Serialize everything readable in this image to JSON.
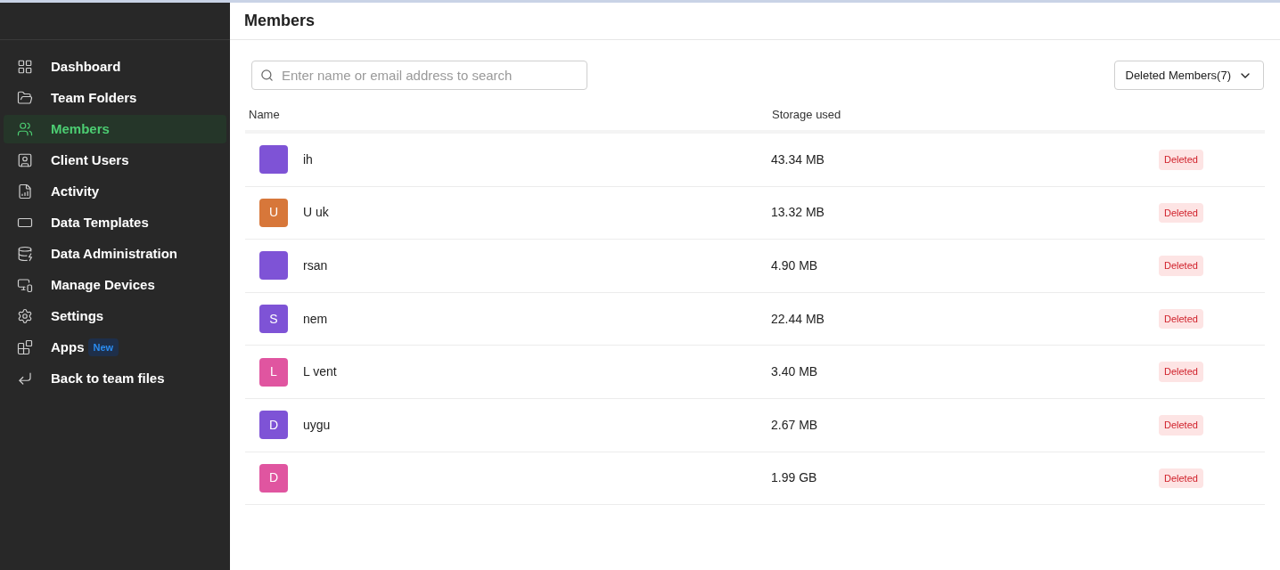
{
  "sidebar": {
    "items": [
      {
        "label": "Dashboard",
        "selected": false
      },
      {
        "label": "Team Folders",
        "selected": false
      },
      {
        "label": "Members",
        "selected": true
      },
      {
        "label": "Client Users",
        "selected": false
      },
      {
        "label": "Activity",
        "selected": false
      },
      {
        "label": "Data Templates",
        "selected": false
      },
      {
        "label": "Data Administration",
        "selected": false
      },
      {
        "label": "Manage Devices",
        "selected": false
      },
      {
        "label": "Settings",
        "selected": false
      },
      {
        "label": "Apps",
        "selected": false,
        "badge": "New"
      },
      {
        "label": "Back to team files",
        "selected": false
      }
    ]
  },
  "page_title": "Members",
  "search": {
    "placeholder": "Enter name or email address to search"
  },
  "filter": {
    "label": "Deleted Members(7)"
  },
  "table": {
    "columns": [
      "Name",
      "Storage used"
    ],
    "rows": [
      {
        "color": "#7e53d6",
        "name": "ih",
        "storage": "43.34 MB",
        "status": "Deleted"
      },
      {
        "initial": "U",
        "color": "#d7773a",
        "name": "U uk",
        "storage": "13.32 MB",
        "status": "Deleted"
      },
      {
        "color": "#7e53d6",
        "name": "rsan",
        "storage": "4.90 MB",
        "status": "Deleted"
      },
      {
        "initial": "S",
        "color": "#7e53d6",
        "name": "nem",
        "storage": "22.44 MB",
        "status": "Deleted"
      },
      {
        "initial": "L",
        "color": "#e055a0",
        "name": "L vent",
        "storage": "3.40 MB",
        "status": "Deleted"
      },
      {
        "initial": "D",
        "color": "#7e53d6",
        "name": "uygu",
        "storage": "2.67 MB",
        "status": "Deleted"
      },
      {
        "initial": "D",
        "color": "#e055a0",
        "storage": "1.99 GB",
        "status": "Deleted"
      }
    ]
  }
}
